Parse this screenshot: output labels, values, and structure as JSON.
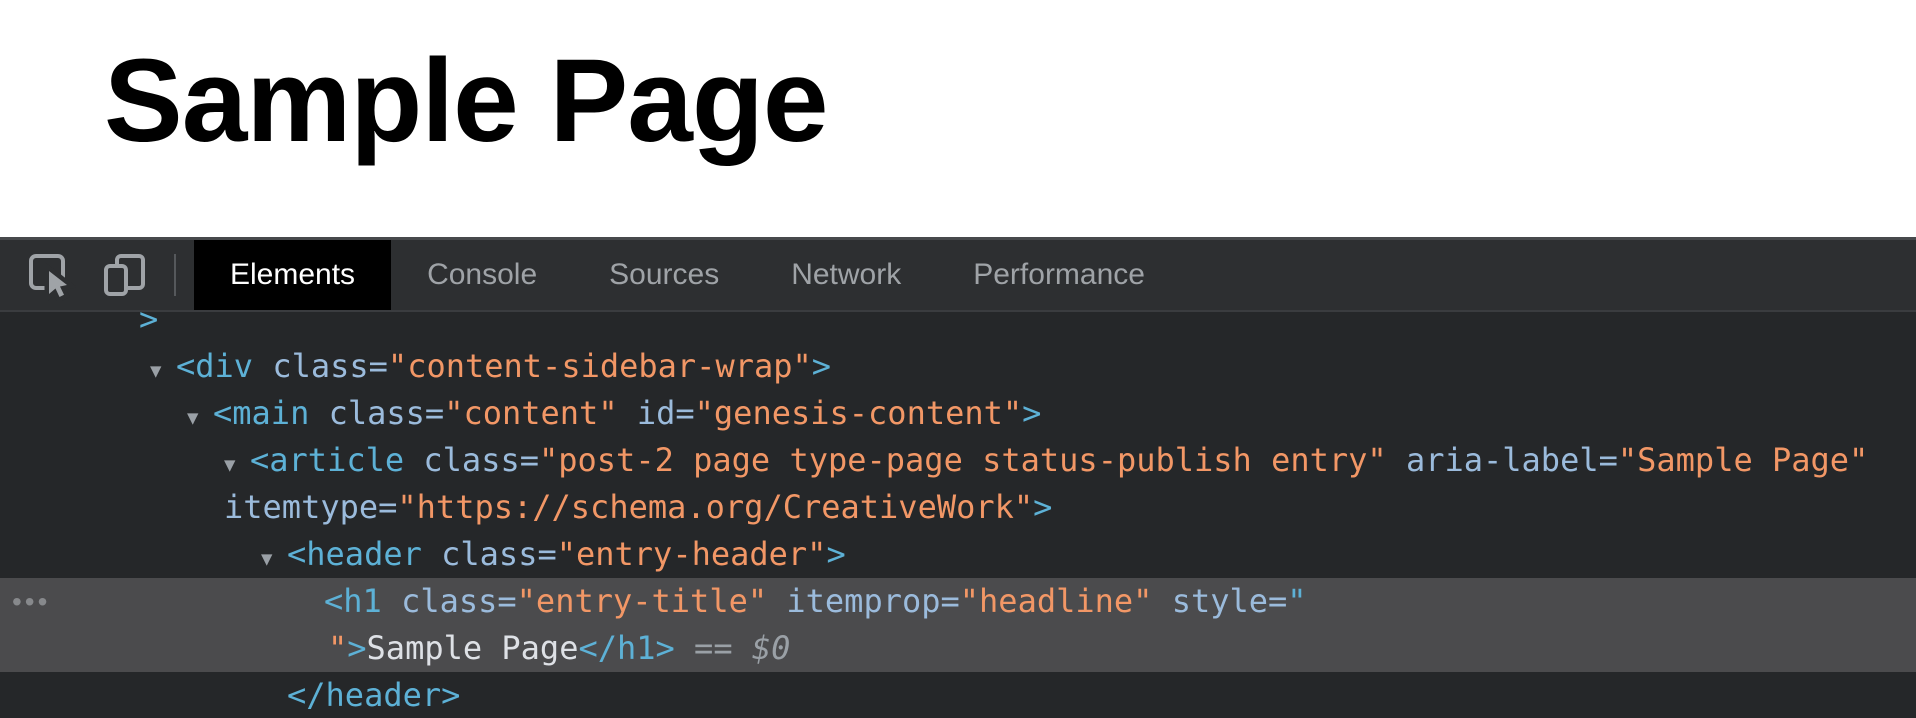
{
  "page": {
    "heading": "Sample Page"
  },
  "devtools": {
    "toolbar": {
      "icons": [
        {
          "name": "inspect-element-icon"
        },
        {
          "name": "toggle-device-toolbar-icon"
        }
      ],
      "tabs": [
        {
          "label": "Elements",
          "active": true
        },
        {
          "label": "Console",
          "active": false
        },
        {
          "label": "Sources",
          "active": false
        },
        {
          "label": "Network",
          "active": false
        },
        {
          "label": "Performance",
          "active": false
        }
      ]
    },
    "elements_panel": {
      "expand_arrow": "▼",
      "gutter_dots": "•••",
      "rows": [
        {
          "depth": 0,
          "arrow": false,
          "cut_top": true,
          "lines": [
            [
              {
                "t": "tag",
                "s": ">"
              }
            ]
          ]
        },
        {
          "depth": 1,
          "arrow": true,
          "lines": [
            [
              {
                "t": "tag",
                "s": "<div"
              },
              {
                "t": "plain",
                "s": " "
              },
              {
                "t": "attr",
                "s": "class="
              },
              {
                "t": "val",
                "s": "\"content-sidebar-wrap\""
              },
              {
                "t": "tag",
                "s": ">"
              }
            ]
          ]
        },
        {
          "depth": 2,
          "arrow": true,
          "lines": [
            [
              {
                "t": "tag",
                "s": "<main"
              },
              {
                "t": "plain",
                "s": " "
              },
              {
                "t": "attr",
                "s": "class="
              },
              {
                "t": "val",
                "s": "\"content\""
              },
              {
                "t": "plain",
                "s": " "
              },
              {
                "t": "attr",
                "s": "id="
              },
              {
                "t": "val",
                "s": "\"genesis-content\""
              },
              {
                "t": "tag",
                "s": ">"
              }
            ]
          ]
        },
        {
          "depth": 3,
          "arrow": true,
          "wrap_align": "arrow",
          "lines": [
            [
              {
                "t": "tag",
                "s": "<article"
              },
              {
                "t": "plain",
                "s": " "
              },
              {
                "t": "attr",
                "s": "class="
              },
              {
                "t": "val",
                "s": "\"post-2 page type-page status-publish entry\""
              },
              {
                "t": "plain",
                "s": " "
              },
              {
                "t": "attr",
                "s": "aria-label="
              },
              {
                "t": "val",
                "s": "\"Sample Page\""
              }
            ],
            [
              {
                "t": "attr",
                "s": "itemtype="
              },
              {
                "t": "val",
                "s": "\"https://schema.org/CreativeWork\""
              },
              {
                "t": "tag",
                "s": ">"
              }
            ]
          ]
        },
        {
          "depth": 4,
          "arrow": true,
          "lines": [
            [
              {
                "t": "tag",
                "s": "<header"
              },
              {
                "t": "plain",
                "s": " "
              },
              {
                "t": "attr",
                "s": "class="
              },
              {
                "t": "val",
                "s": "\"entry-header\""
              },
              {
                "t": "tag",
                "s": ">"
              }
            ]
          ]
        },
        {
          "depth": 5,
          "arrow": false,
          "selected": true,
          "dots": true,
          "wrap_align": "text",
          "lines": [
            [
              {
                "t": "tag",
                "s": "<h1"
              },
              {
                "t": "plain",
                "s": " "
              },
              {
                "t": "attr",
                "s": "class="
              },
              {
                "t": "val",
                "s": "\"entry-title\""
              },
              {
                "t": "plain",
                "s": " "
              },
              {
                "t": "attr",
                "s": "itemprop="
              },
              {
                "t": "val",
                "s": "\"headline\""
              },
              {
                "t": "plain",
                "s": " "
              },
              {
                "t": "attr",
                "s": "style="
              },
              {
                "t": "tag",
                "s": "\""
              }
            ],
            [
              {
                "t": "val",
                "s": "\""
              },
              {
                "t": "tag",
                "s": ">"
              },
              {
                "t": "plain",
                "s": "Sample Page"
              },
              {
                "t": "tag",
                "s": "</h1>"
              },
              {
                "t": "meta",
                "s": " == "
              },
              {
                "t": "meta-italic",
                "s": "$0"
              }
            ]
          ]
        },
        {
          "depth": 4,
          "arrow": false,
          "lines": [
            [
              {
                "t": "tag",
                "s": "</header>"
              }
            ]
          ]
        }
      ]
    }
  },
  "theme": {
    "page_bg": "#ffffff",
    "heading_color": "#000000",
    "toolbar_bg": "#2d2f31",
    "toolbar_top_border": "#47494c",
    "toolbar_bottom_border": "#3a3c3f",
    "tab_active_bg": "#000000",
    "tab_active_text": "#ffffff",
    "tab_text": "#9fa3a7",
    "icon": "#9fa3a7",
    "divider": "#55585b",
    "code_bg": "#252729",
    "selected_row_bg": "#4b4b4d",
    "tag": "#5db1d6",
    "attr": "#9bbbdc",
    "val": "#f29766",
    "plain": "#dee1e6",
    "meta": "#9aa0a6",
    "arrow": "#9aa0a6",
    "dots": "#87898c"
  }
}
